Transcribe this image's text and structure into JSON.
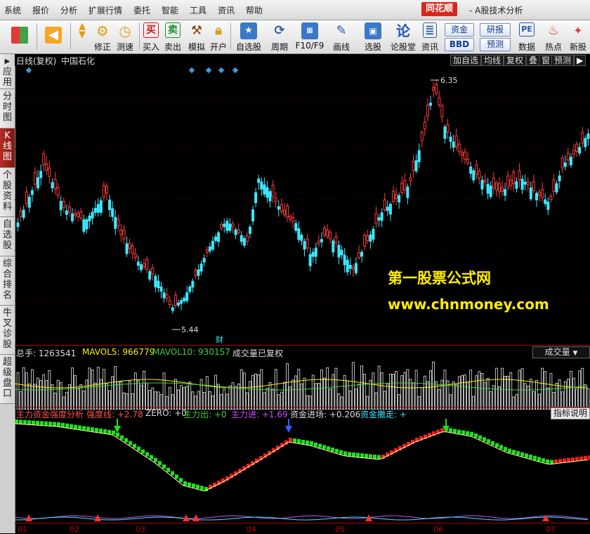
{
  "menu": {
    "items": [
      "系统",
      "报价",
      "分析",
      "扩展行情",
      "委托",
      "智能",
      "工具",
      "资讯",
      "帮助"
    ],
    "brand": "同花顺",
    "app_title": "- A股技术分析"
  },
  "toolbar": {
    "buttons": [
      {
        "label": "",
        "icon": "layout-grid-icon"
      },
      {
        "label": "",
        "icon": "back-arrow-icon"
      },
      {
        "label": "",
        "icon": "up-down-arrows-icon"
      },
      {
        "label": "修正",
        "icon": "gear-icon"
      },
      {
        "label": "测速",
        "icon": "clock-icon"
      },
      {
        "label": "买入",
        "icon": "buy-icon",
        "glyph": "买"
      },
      {
        "label": "卖出",
        "icon": "sell-icon",
        "glyph": "卖"
      },
      {
        "label": "模拟",
        "icon": "hammer-icon"
      },
      {
        "label": "开户",
        "icon": "lock-icon"
      },
      {
        "label": "自选股",
        "icon": "star-folder-icon"
      },
      {
        "label": "周期",
        "icon": "cycle-icon"
      },
      {
        "label": "F10/F9",
        "icon": "f10-icon"
      },
      {
        "label": "画线",
        "icon": "pencil-icon"
      },
      {
        "label": "选股",
        "icon": "monitor-icon"
      },
      {
        "label": "论股堂",
        "icon": "forum-icon",
        "glyph": "论"
      },
      {
        "label": "资讯",
        "icon": "news-icon"
      },
      {
        "label": "数据",
        "icon": "pe-icon",
        "glyph": "PE"
      },
      {
        "label": "热点",
        "icon": "hot-icon"
      },
      {
        "label": "新股",
        "icon": "new-stock-icon"
      }
    ],
    "pills": [
      "资金",
      "研报",
      "BBD",
      "预测"
    ]
  },
  "side_tabs": [
    "应用",
    "分时图",
    "K线图",
    "个股资料",
    "自选股",
    "综合排名",
    "牛叉诊股",
    "超级盘口"
  ],
  "chart_header": {
    "period_label": "日线(复权)",
    "stock_name": "中国石化",
    "buttons": [
      "加自选",
      "均线",
      "复权",
      "叠",
      "窗",
      "预测"
    ]
  },
  "main_chart": {
    "high_label": "6.35",
    "low_label": "5.44",
    "cai_label": "财",
    "colors": {
      "up": "#ff3c3c",
      "down": "#3ce8ff"
    }
  },
  "watermark": {
    "line1": "第一股票公式网",
    "line2": "www.chnmoney.com"
  },
  "volume_header": {
    "total_label": "总手: 1263541",
    "mavol5_label": "MAVOL5: 966779",
    "mavol10_label": "MAVOL10: 930157",
    "note": "成交量已复权",
    "selector_value": "成交量"
  },
  "indicator_header": {
    "title": "主力资金强度分析",
    "strength": "强度线: +2.78",
    "zero": "ZERO: +0",
    "main_out": "主力出: +0",
    "main_in": "主力进: +1.69",
    "fund_in": "资金进场: +0.206",
    "fund_out": "资金撤走: +",
    "help_button": "指标说明"
  },
  "time_axis": [
    "01",
    "02",
    "03",
    "04",
    "05",
    "06",
    "07"
  ]
}
